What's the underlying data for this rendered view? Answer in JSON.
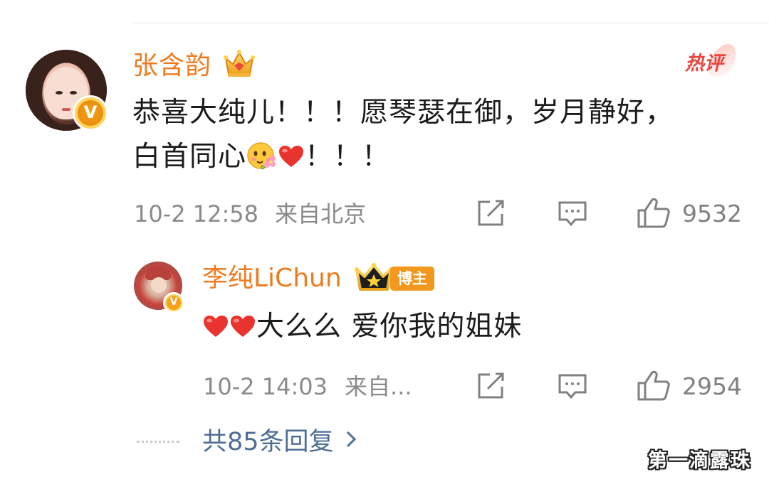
{
  "main_comment": {
    "username": "张含韵",
    "hot_label": "热评",
    "text_line1": "恭喜大纯儿！！！愿琴瑟在御，岁月静好，",
    "text_line2_before": "白首同心",
    "text_line2_after": "！！！",
    "emoji_names": [
      "sticker-flower-face-icon",
      "heart-icon"
    ],
    "time": "10-2 12:58",
    "location": "来自北京",
    "like_count": "9532"
  },
  "reply": {
    "username": "李纯LiChun",
    "badge_label": "博主",
    "text": "大么么 爱你我的姐妹",
    "time": "10-2 14:03",
    "location": "来自...",
    "like_count": "2954"
  },
  "more_replies": {
    "label": "共85条回复"
  },
  "watermark": "第一滴露珠",
  "colors": {
    "username": "#f07b1f",
    "hot": "#e8453f",
    "link": "#4e6e96",
    "meta": "#8a8a8a",
    "badge": "#f3981f",
    "verify": "#f7a11a"
  }
}
